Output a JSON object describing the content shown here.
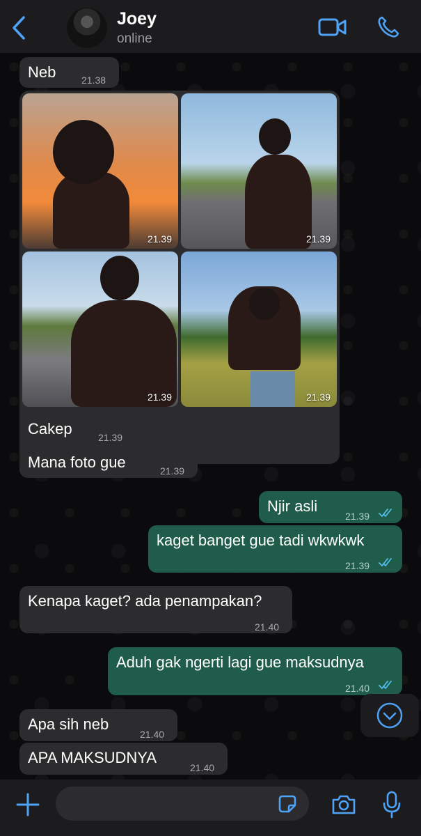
{
  "header": {
    "contact_name": "Joey",
    "status": "online"
  },
  "messages": [
    {
      "dir": "in",
      "text": "Neb",
      "time": "21.38"
    },
    {
      "dir": "in",
      "type": "photos",
      "times": [
        "21.39",
        "21.39",
        "21.39",
        "21.39"
      ]
    },
    {
      "dir": "in",
      "text": "Cakep",
      "time": "21.39"
    },
    {
      "dir": "in",
      "text": "Mana foto gue",
      "time": "21.39"
    },
    {
      "dir": "out",
      "text": "Njir asli",
      "time": "21.39",
      "read": true
    },
    {
      "dir": "out",
      "text": "kaget banget gue tadi wkwkwk",
      "time": "21.39",
      "read": true
    },
    {
      "dir": "in",
      "text": "Kenapa kaget? ada penampakan?",
      "time": "21.40"
    },
    {
      "dir": "out",
      "text": "Aduh gak ngerti lagi gue maksudnya",
      "time": "21.40",
      "read": true
    },
    {
      "dir": "in",
      "text": "Apa sih neb",
      "time": "21.40"
    },
    {
      "dir": "in",
      "text": "APA MAKSUDNYA",
      "time": "21.40"
    }
  ],
  "composer": {
    "value": "",
    "placeholder": ""
  },
  "icons": {
    "back": "chevron-left-icon",
    "video": "video-camera-icon",
    "call": "phone-icon",
    "scroll": "chevron-down-circle-icon",
    "add": "plus-icon",
    "sticker": "sticker-icon",
    "camera": "camera-icon",
    "mic": "microphone-icon"
  },
  "colors": {
    "accent": "#4fa3f7",
    "incoming_bubble": "#2c2c2e",
    "outgoing_bubble": "#1f5c4a",
    "read_ticks": "#53bdeb"
  }
}
